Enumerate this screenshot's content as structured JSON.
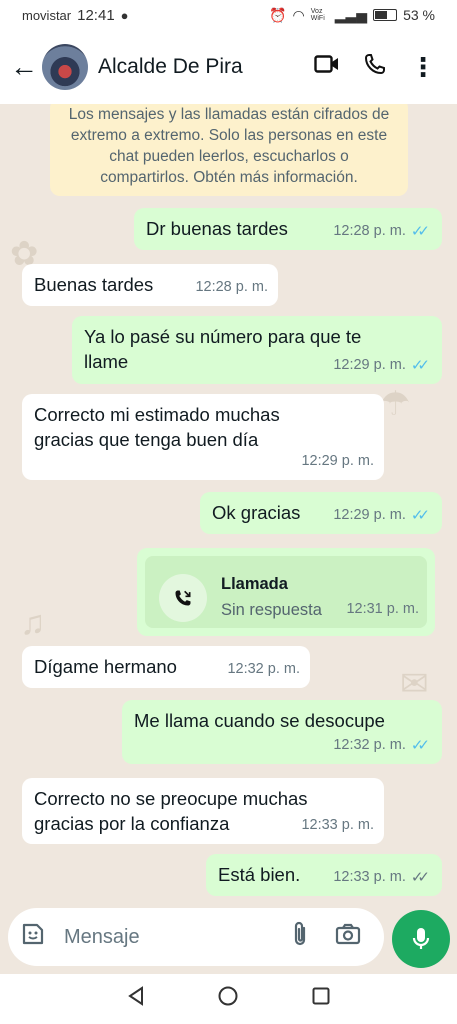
{
  "status_bar": {
    "carrier": "movistar",
    "time": "12:41",
    "volte": "Voz WiFi",
    "battery": "53 %"
  },
  "header": {
    "contact_name": "Alcalde De Pira"
  },
  "encryption_notice": "Los mensajes y las llamadas están cifrados de extremo a extremo. Solo las personas en este chat pueden leerlos, escucharlos o compartirlos. Obtén más información.",
  "messages": [
    {
      "dir": "out",
      "text": "Dr buenas tardes",
      "time": "12:28 p. m."
    },
    {
      "dir": "in",
      "text": "Buenas tardes",
      "time": "12:28 p. m."
    },
    {
      "dir": "out",
      "text": "Ya lo pasé su número para que te llame",
      "time": "12:29 p. m."
    },
    {
      "dir": "in",
      "text": "Correcto mi estimado muchas gracias que tenga buen día",
      "time": "12:29 p. m."
    },
    {
      "dir": "out",
      "text": "Ok gracias",
      "time": "12:29 p. m."
    },
    {
      "dir": "out",
      "type": "call",
      "title": "Llamada",
      "subtitle": "Sin respuesta",
      "time": "12:31 p. m."
    },
    {
      "dir": "in",
      "text": "Dígame hermano",
      "time": "12:32 p. m."
    },
    {
      "dir": "out",
      "text": "Me llama cuando se desocupe",
      "time": "12:32 p. m."
    },
    {
      "dir": "in",
      "text": "Correcto no se preocupe muchas gracias por la confianza",
      "time": "12:33 p. m."
    },
    {
      "dir": "out",
      "text": "Está bien.",
      "time": "12:33 p. m."
    }
  ],
  "composer": {
    "placeholder": "Mensaje"
  },
  "icons": {
    "back": "arrow-left-icon",
    "video": "video-call-icon",
    "phone": "phone-icon",
    "menu": "more-vert-icon",
    "sticker": "sticker-icon",
    "attach": "paperclip-icon",
    "camera": "camera-icon",
    "mic": "mic-icon"
  },
  "colors": {
    "outgoing_bubble": "#d9fdd3",
    "incoming_bubble": "#ffffff",
    "accent_green": "#1daa61",
    "read_tick": "#53bdeb"
  }
}
